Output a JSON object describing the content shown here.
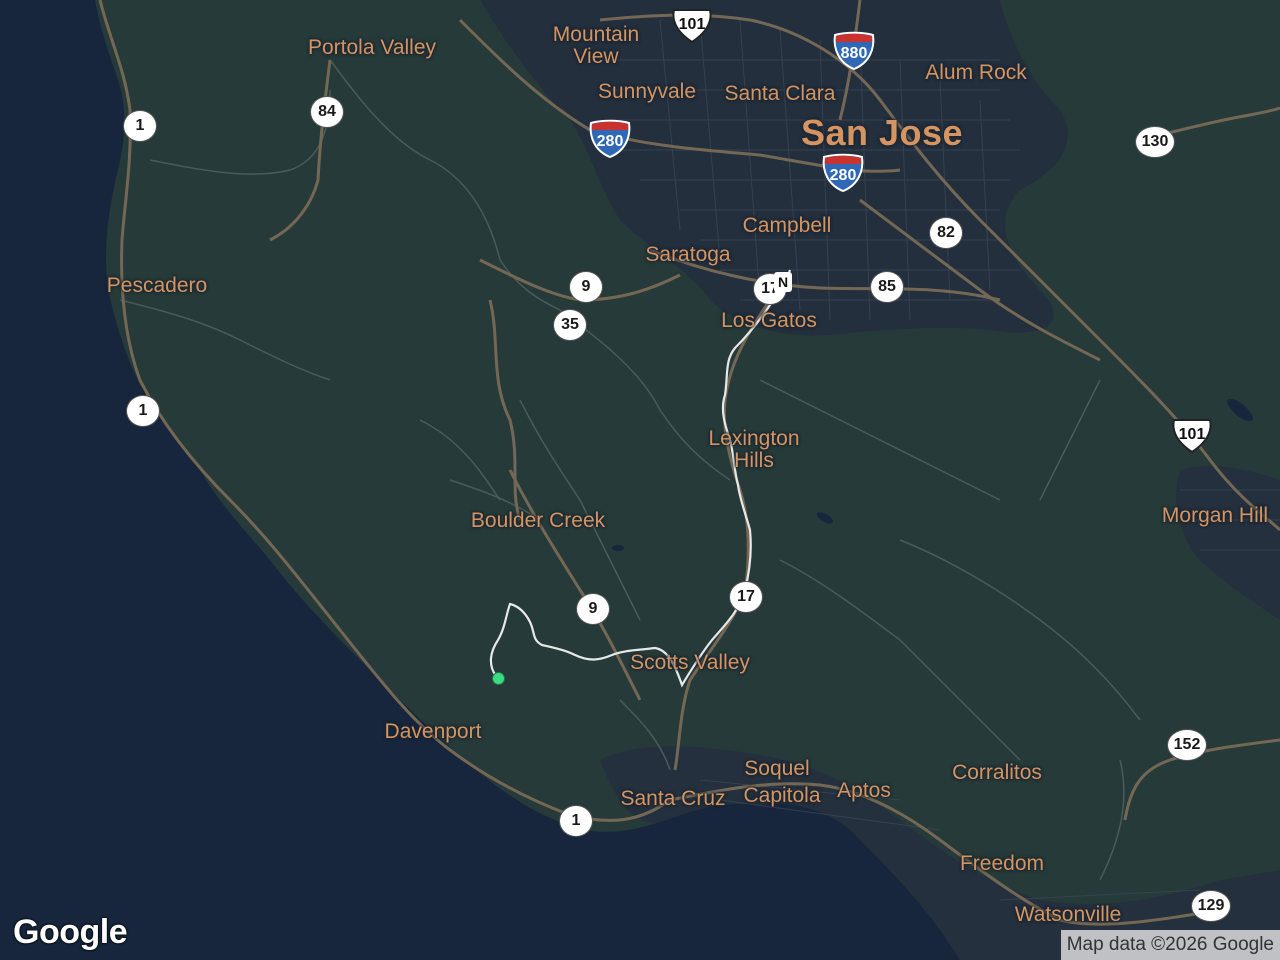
{
  "places": {
    "portola_valley": "Portola Valley",
    "mountain_view": "Mountain\nView",
    "sunnyvale": "Sunnyvale",
    "santa_clara": "Santa Clara",
    "san_jose": "San Jose",
    "alum_rock": "Alum Rock",
    "campbell": "Campbell",
    "saratoga": "Saratoga",
    "los_gatos": "Los Gatos",
    "pescadero": "Pescadero",
    "lexington_hills": "Lexington\nHills",
    "boulder_creek": "Boulder Creek",
    "morgan_hill": "Morgan Hill",
    "scotts_valley": "Scotts Valley",
    "davenport": "Davenport",
    "soquel": "Soquel",
    "santa_cruz": "Santa Cruz",
    "capitola": "Capitola",
    "aptos": "Aptos",
    "corralitos": "Corralitos",
    "freedom": "Freedom",
    "watsonville": "Watsonville"
  },
  "routes": {
    "us101_top": "101",
    "us101_right": "101",
    "i880": "880",
    "i280_west": "280",
    "i280_east": "280",
    "r84": "84",
    "r1_top": "1",
    "r1_mid": "1",
    "r1_bottom": "1",
    "r130": "130",
    "r82": "82",
    "r9_top": "9",
    "r35": "35",
    "r85": "85",
    "r17_top": "17",
    "r17": "17",
    "r9_bottom": "9",
    "r152": "152",
    "r129": "129"
  },
  "markers": {
    "north_marker": "N"
  },
  "branding": {
    "logo": "Google",
    "attribution": "Map data ©2026 Google"
  },
  "colors": {
    "water": "#17263c",
    "land": "#263a3a",
    "urban": "#242f3e",
    "road": "#746855",
    "route_path": "#e8e8e8",
    "start_marker": "#3ddc84",
    "label": "#d59563"
  }
}
